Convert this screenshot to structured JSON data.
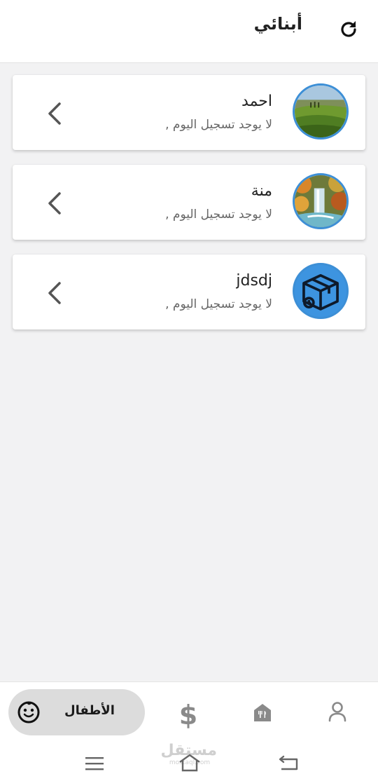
{
  "header": {
    "title": "أبنائي",
    "refresh_icon": "refresh-icon"
  },
  "children": [
    {
      "name": "احمد",
      "status": "لا يوجد تسجيل اليوم ,",
      "avatar": "landscape-field-image"
    },
    {
      "name": "منة",
      "status": "لا يوجد تسجيل اليوم ,",
      "avatar": "waterfall-image"
    },
    {
      "name": "jdsdj",
      "status": "لا يوجد تسجيل اليوم ,",
      "avatar": "box-delivery-icon"
    }
  ],
  "bottom_nav": {
    "active_label": "الأطفال",
    "items": [
      "child-face-icon",
      "dollar-icon",
      "restaurant-icon",
      "person-icon"
    ]
  },
  "system_nav": [
    "menu-icon",
    "home-icon",
    "back-icon"
  ],
  "watermark": {
    "text": "مستقل",
    "sub": "mostaql.com"
  },
  "colors": {
    "accent_border": "#3d8fd6",
    "background": "#f2f2f3",
    "pill": "#dcdcdc"
  }
}
